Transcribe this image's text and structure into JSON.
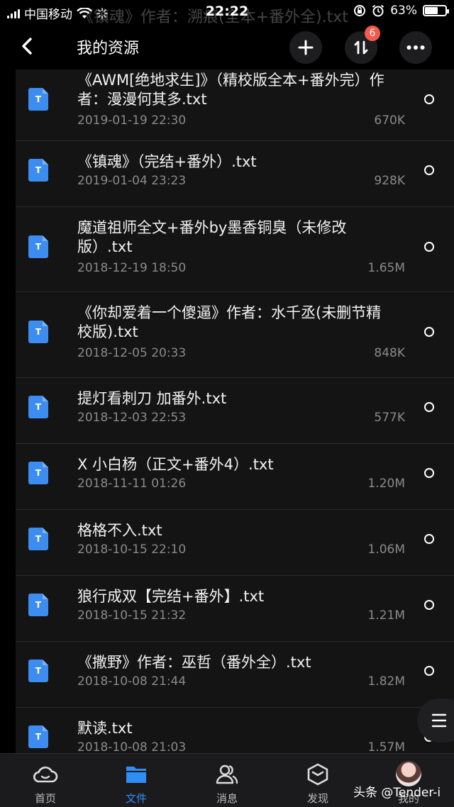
{
  "status_bar": {
    "carrier": "中国移动",
    "time": "22:22",
    "battery_text": "63%",
    "battery_level": 0.63
  },
  "ghost_title": "《镇魂》作者：溯痕(全本+番外全).txt",
  "header": {
    "title": "我的资源",
    "badge_count": "6"
  },
  "files": [
    {
      "name": "《AWM[绝地求生]》（精校版全本+番外完）作者：漫漫何其多.txt",
      "date": "2019-01-19 22:30",
      "size": "670K"
    },
    {
      "name": "《镇魂》（完结+番外）.txt",
      "date": "2019-01-04 23:23",
      "size": "928K"
    },
    {
      "name": "魔道祖师全文+番外by墨香铜臭（未修改版）.txt",
      "date": "2018-12-19 18:50",
      "size": "1.65M"
    },
    {
      "name": "《你却爱着一个傻逼》作者：水千丞(未删节精校版).txt",
      "date": "2018-12-05 20:33",
      "size": "848K"
    },
    {
      "name": "提灯看刺刀 加番外.txt",
      "date": "2018-12-03 22:53",
      "size": "577K"
    },
    {
      "name": "X 小白杨（正文+番外4）.txt",
      "date": "2018-11-11 01:26",
      "size": "1.20M"
    },
    {
      "name": "格格不入.txt",
      "date": "2018-10-15 22:10",
      "size": "1.06M"
    },
    {
      "name": "狼行成双【完结+番外】.txt",
      "date": "2018-10-15 21:32",
      "size": "1.21M"
    },
    {
      "name": "《撒野》作者：巫哲（番外全）.txt",
      "date": "2018-10-08 21:44",
      "size": "1.82M"
    },
    {
      "name": "默读.txt",
      "date": "2018-10-08 21:03",
      "size": "1.57M"
    }
  ],
  "file_icon_letter": "T",
  "tabs": [
    {
      "label": "首页",
      "icon": "home-cloud-icon"
    },
    {
      "label": "文件",
      "icon": "folder-icon"
    },
    {
      "label": "消息",
      "icon": "people-icon"
    },
    {
      "label": "发现",
      "icon": "discover-box-icon"
    },
    {
      "label": "我的",
      "icon": "avatar"
    }
  ],
  "watermark": "头条 @Tender-i",
  "colors": {
    "accent": "#2f8ef6",
    "badge": "#f25a4a",
    "file_icon": "#3d8cf0"
  }
}
